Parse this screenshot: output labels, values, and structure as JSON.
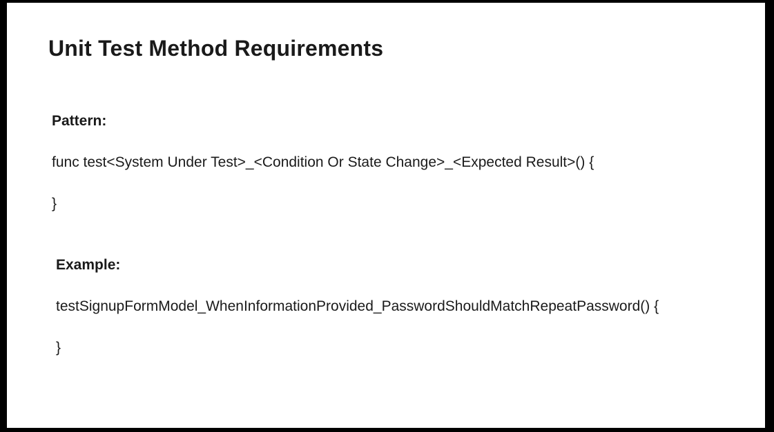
{
  "slide": {
    "title": "Unit Test Method Requirements",
    "pattern": {
      "label": "Pattern:",
      "signature": "func test<System Under Test>_<Condition Or State Change>_<Expected Result>() {",
      "closing": "}"
    },
    "example": {
      "label": "Example:",
      "signature": "testSignupFormModel_WhenInformationProvided_PasswordShouldMatchRepeatPassword() {",
      "closing": "}"
    }
  }
}
